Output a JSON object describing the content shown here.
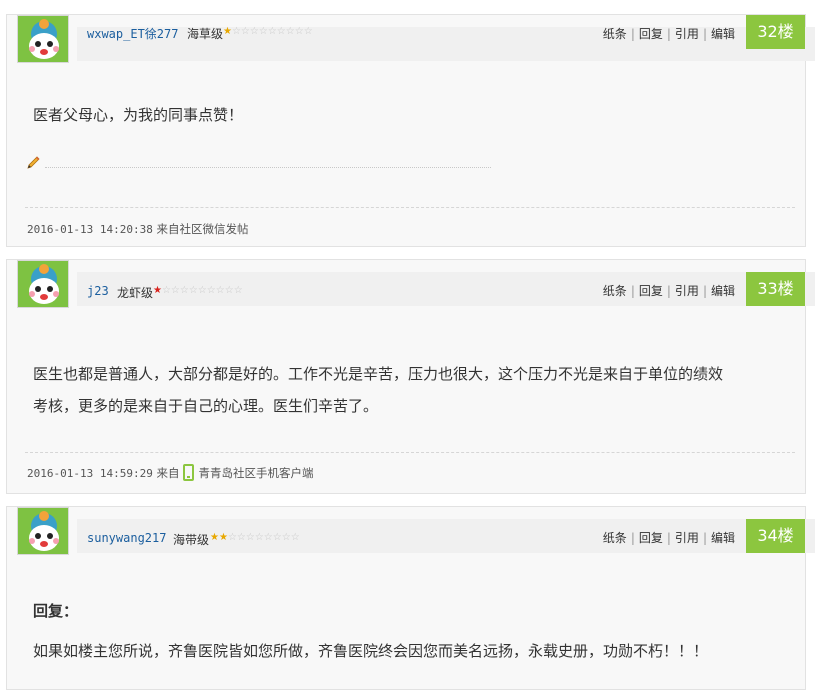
{
  "posts": [
    {
      "username": "wxwap_ET徐277",
      "level": "海草级",
      "stars_on": 1,
      "stars_total": 10,
      "star_color": "#e8a800",
      "actions": [
        "纸条",
        "回复",
        "引用",
        "编辑"
      ],
      "floor": "32楼",
      "content": [
        "医者父母心，为我的同事点赞！"
      ],
      "time": "2016-01-13 14:20:38",
      "source_prefix": "来自",
      "source": "来自社区微信发帖"
    },
    {
      "username": "j23",
      "level": "龙虾级",
      "stars_on": 1,
      "stars_total": 10,
      "star_color": "#d8231d",
      "actions": [
        "纸条",
        "回复",
        "引用",
        "编辑"
      ],
      "floor": "33楼",
      "content": [
        "医生也都是普通人，大部分都是好的。工作不光是辛苦，压力也很大，这个压力不光是来自于单位的绩效",
        "考核，更多的是来自于自己的心理。医生们辛苦了。"
      ],
      "time": "2016-01-13 14:59:29",
      "source_prefix": "来自",
      "source": "青青岛社区手机客户端"
    },
    {
      "username": "sunywang217",
      "level": "海带级",
      "stars_on": 2,
      "stars_total": 10,
      "star_color": "#e8a800",
      "actions": [
        "纸条",
        "回复",
        "引用",
        "编辑"
      ],
      "floor": "34楼",
      "reply_label": "回复：",
      "content": [
        "如果如楼主您所说，齐鲁医院皆如您所做，齐鲁医院终会因您而美名远扬，永载史册，功勋不朽！！！"
      ]
    }
  ],
  "icons": {
    "avatar": "mascot-avatar-icon",
    "edit": "pencil-icon",
    "client": "mobile-phone-icon",
    "star": "star-icon"
  },
  "colors": {
    "accent": "#8cc63f",
    "link": "#1b5e9e",
    "star_gold": "#e8a800",
    "star_red": "#d8231d"
  }
}
